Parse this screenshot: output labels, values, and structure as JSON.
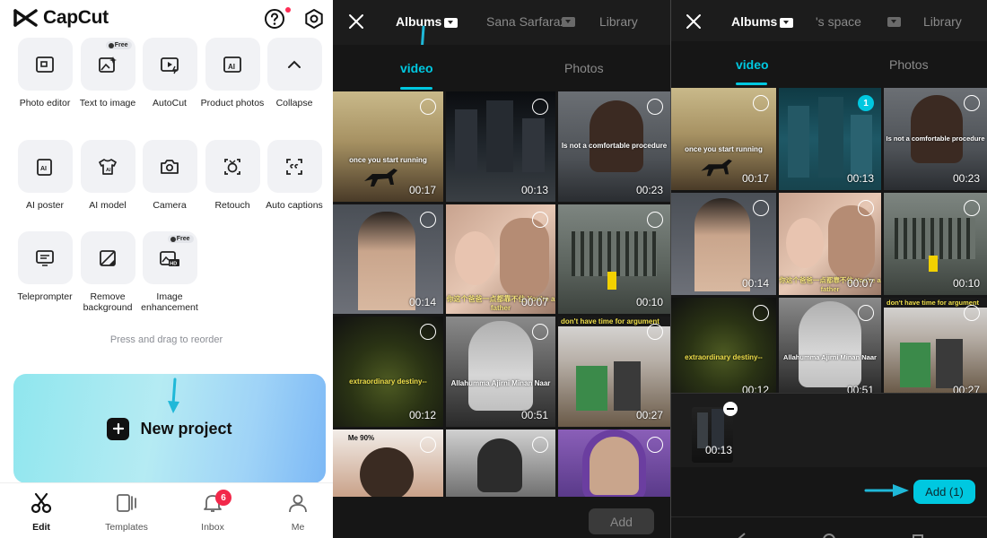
{
  "home": {
    "app_name": "CapCut",
    "tools": [
      {
        "label": "Photo editor"
      },
      {
        "label": "Text to image",
        "badge": "Free"
      },
      {
        "label": "AutoCut"
      },
      {
        "label": "Product photos"
      },
      {
        "label": "Collapse"
      },
      {
        "label": "AI poster"
      },
      {
        "label": "AI model"
      },
      {
        "label": "Camera"
      },
      {
        "label": "Retouch"
      },
      {
        "label": "Auto captions"
      },
      {
        "label": "Teleprompter"
      },
      {
        "label": "Remove background"
      },
      {
        "label": "Image enhancement",
        "badge": "Free"
      }
    ],
    "reorder_hint": "Press and drag to reorder",
    "new_project_label": "New project",
    "nav": [
      {
        "label": "Edit",
        "icon": "scissors-icon"
      },
      {
        "label": "Templates",
        "icon": "templates-icon"
      },
      {
        "label": "Inbox",
        "icon": "bell-icon",
        "badge": "6"
      },
      {
        "label": "Me",
        "icon": "person-icon"
      }
    ]
  },
  "picker": {
    "tabs": [
      "Albums",
      "Sana Sarfaraz",
      "Library"
    ],
    "subtabs": [
      "video",
      "Photos"
    ],
    "thumbs": [
      {
        "duration": "00:17",
        "caption": "once you start running"
      },
      {
        "duration": "00:13",
        "caption": ""
      },
      {
        "duration": "00:23",
        "caption": "Is not a comfortable procedure"
      },
      {
        "duration": "00:14",
        "caption": ""
      },
      {
        "duration": "00:07",
        "caption": "你这个爸爸一点都靠不住 You're a father"
      },
      {
        "duration": "00:10",
        "caption": ""
      },
      {
        "duration": "00:12",
        "caption": "extraordinary destiny--"
      },
      {
        "duration": "00:51",
        "caption": "Allahumma Ajirni Minan Naar"
      },
      {
        "duration": "00:27",
        "caption": "don't have time for argument"
      },
      {
        "duration": "",
        "caption": "Me 90%"
      },
      {
        "duration": "",
        "caption": ""
      },
      {
        "duration": "",
        "caption": ""
      }
    ],
    "add_label": "Add"
  },
  "picker2": {
    "tabs": [
      "Albums",
      "'s space",
      "Library"
    ],
    "subtabs": [
      "video",
      "Photos"
    ],
    "selected_index": "1",
    "thumbs": [
      {
        "duration": "00:17",
        "caption": "once you start running"
      },
      {
        "duration": "00:13",
        "caption": ""
      },
      {
        "duration": "00:23",
        "caption": "Is not a comfortable procedure"
      },
      {
        "duration": "00:14",
        "caption": ""
      },
      {
        "duration": "00:07",
        "caption": "你这个爸爸一点都靠不住 You're a father"
      },
      {
        "duration": "00:10",
        "caption": ""
      },
      {
        "duration": "00:12",
        "caption": "extraordinary destiny--"
      },
      {
        "duration": "00:51",
        "caption": "Allahumma Ajirni Minan Naar"
      },
      {
        "duration": "00:27",
        "caption": "don't have time for argument"
      }
    ],
    "selected_duration": "00:13",
    "add_label": "Add (1)"
  },
  "colors": {
    "accent": "#00c8e0",
    "dark_bg": "#161616"
  }
}
